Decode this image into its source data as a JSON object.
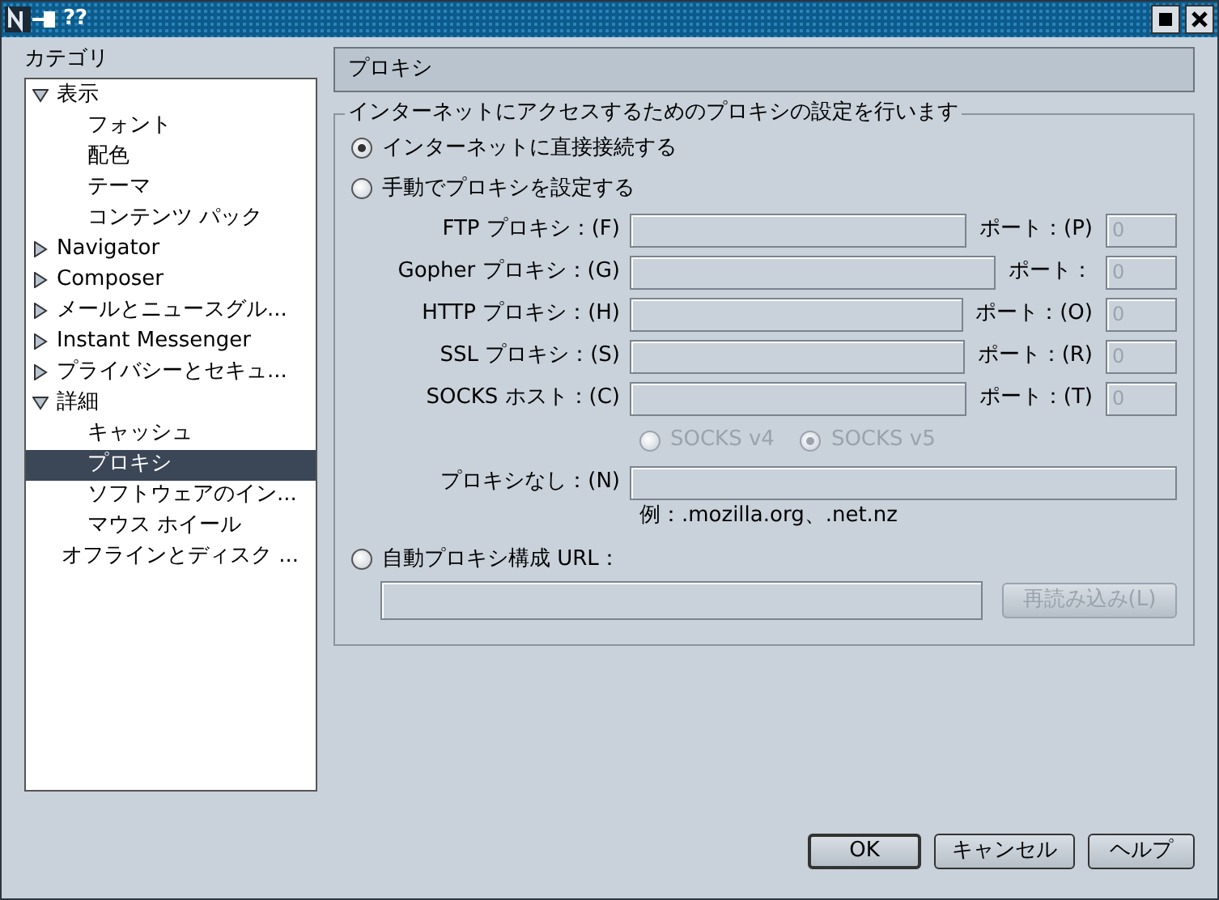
{
  "window": {
    "title": "??"
  },
  "sidebar": {
    "label": "カテゴリ",
    "items": [
      {
        "label": "表示",
        "expanded": true,
        "selected": false,
        "children": [
          {
            "label": "フォント",
            "selected": false
          },
          {
            "label": "配色",
            "selected": false
          },
          {
            "label": "テーマ",
            "selected": false
          },
          {
            "label": "コンテンツ パック",
            "selected": false
          }
        ]
      },
      {
        "label": "Navigator",
        "expanded": false,
        "selected": false
      },
      {
        "label": "Composer",
        "expanded": false,
        "selected": false
      },
      {
        "label": "メールとニュースグル...",
        "expanded": false,
        "selected": false
      },
      {
        "label": "Instant Messenger",
        "expanded": false,
        "selected": false
      },
      {
        "label": "プライバシーとセキュ...",
        "expanded": false,
        "selected": false
      },
      {
        "label": "詳細",
        "expanded": true,
        "selected": false,
        "children": [
          {
            "label": "キャッシュ",
            "selected": false
          },
          {
            "label": "プロキシ",
            "selected": true
          },
          {
            "label": "ソフトウェアのイン...",
            "selected": false
          },
          {
            "label": "マウス ホイール",
            "selected": false
          }
        ]
      },
      {
        "label": "オフラインとディスク ...",
        "selected": false
      }
    ]
  },
  "panel": {
    "title": "プロキシ",
    "group_label": "インターネットにアクセスするためのプロキシの設定を行います",
    "options": [
      {
        "label": "インターネットに直接接続する",
        "selected": true
      },
      {
        "label": "手動でプロキシを設定する",
        "selected": false
      },
      {
        "label": "自動プロキシ構成 URL：",
        "selected": false
      }
    ],
    "manual": {
      "disabled": true,
      "proxies": [
        {
          "label": "FTP プロキシ：(F)",
          "port_label": "ポート：(P)",
          "port": "0"
        },
        {
          "label": "Gopher プロキシ：(G)",
          "port_label": "ポート：",
          "port": "0"
        },
        {
          "label": "HTTP プロキシ：(H)",
          "port_label": "ポート：(O)",
          "port": "0"
        },
        {
          "label": "SSL プロキシ：(S)",
          "port_label": "ポート：(R)",
          "port": "0"
        },
        {
          "label": "SOCKS ホスト：(C)",
          "port_label": "ポート：(T)",
          "port": "0"
        }
      ],
      "socks_versions": [
        {
          "label": "SOCKS v4",
          "selected": false
        },
        {
          "label": "SOCKS v5",
          "selected": true
        }
      ],
      "no_proxy_label": "プロキシなし：(N)",
      "example": "例：.mozilla.org、.net.nz"
    },
    "auto": {
      "disabled": true,
      "reload_button": "再読み込み(L)"
    }
  },
  "buttons": [
    {
      "label": "OK",
      "default": true
    },
    {
      "label": "キャンセル",
      "default": false
    },
    {
      "label": "ヘルプ",
      "default": false
    }
  ]
}
